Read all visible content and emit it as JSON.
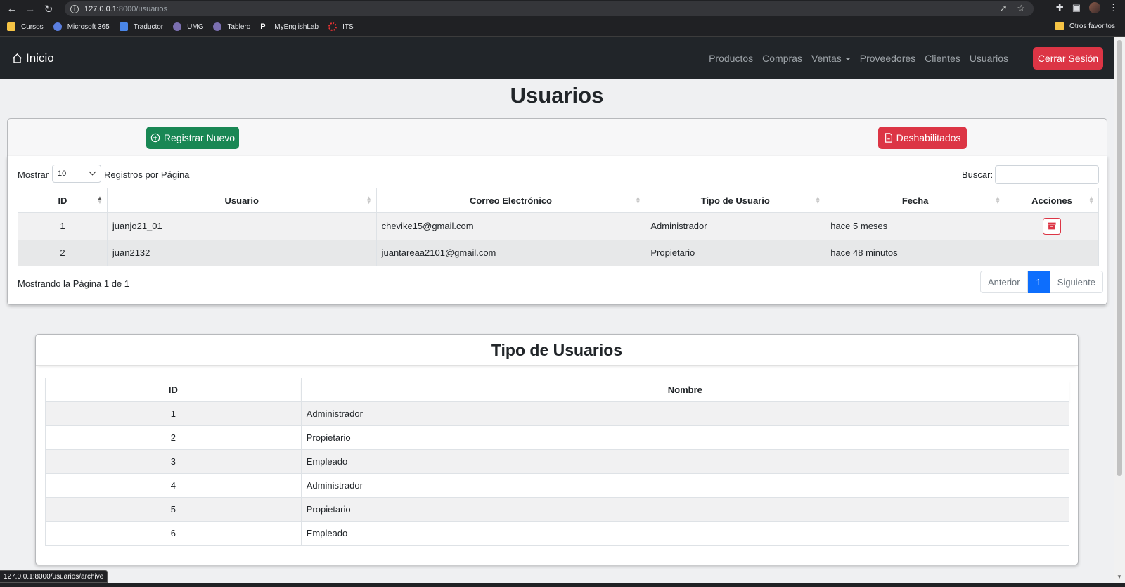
{
  "browser": {
    "url_host": "127.0.0.1",
    "url_path": ":8000/usuarios",
    "bookmarks": [
      "Cursos",
      "Microsoft 365",
      "Traductor",
      "UMG",
      "Tablero",
      "MyEnglishLab",
      "ITS"
    ],
    "other_favorites": "Otros favoritos",
    "status_url": "127.0.0.1:8000/usuarios/archive"
  },
  "navbar": {
    "brand": "Inicio",
    "links": [
      "Productos",
      "Compras",
      "Ventas",
      "Proveedores",
      "Clientes",
      "Usuarios"
    ],
    "logout": "Cerrar Sesión"
  },
  "page": {
    "title": "Usuarios",
    "register_button": "Registrar Nuevo",
    "disabled_button": "Deshabilitados"
  },
  "users_table": {
    "show_label": "Mostrar",
    "page_size": "10",
    "rpp_label": "Registros por Página",
    "search_label": "Buscar:",
    "columns": [
      "ID",
      "Usuario",
      "Correo Electrónico",
      "Tipo de Usuario",
      "Fecha",
      "Acciones"
    ],
    "rows": [
      {
        "id": "1",
        "usuario": "juanjo21_01",
        "correo": "chevike15@gmail.com",
        "tipo": "Administrador",
        "fecha": "hace 5 meses"
      },
      {
        "id": "2",
        "usuario": "juan2132",
        "correo": "juantareaa2101@gmail.com",
        "tipo": "Propietario",
        "fecha": "hace 48 minutos"
      }
    ],
    "page_info": "Mostrando la Página 1 de 1",
    "prev": "Anterior",
    "current_page": "1",
    "next": "Siguiente"
  },
  "types": {
    "title": "Tipo de Usuarios",
    "columns": [
      "ID",
      "Nombre"
    ],
    "rows": [
      {
        "id": "1",
        "nombre": "Administrador"
      },
      {
        "id": "2",
        "nombre": "Propietario"
      },
      {
        "id": "3",
        "nombre": "Empleado"
      },
      {
        "id": "4",
        "nombre": "Administrador"
      },
      {
        "id": "5",
        "nombre": "Propietario"
      },
      {
        "id": "6",
        "nombre": "Empleado"
      }
    ]
  },
  "colors": {
    "navbar": "#212529",
    "success": "#198754",
    "danger": "#dc3545",
    "primary": "#0d6efd"
  }
}
